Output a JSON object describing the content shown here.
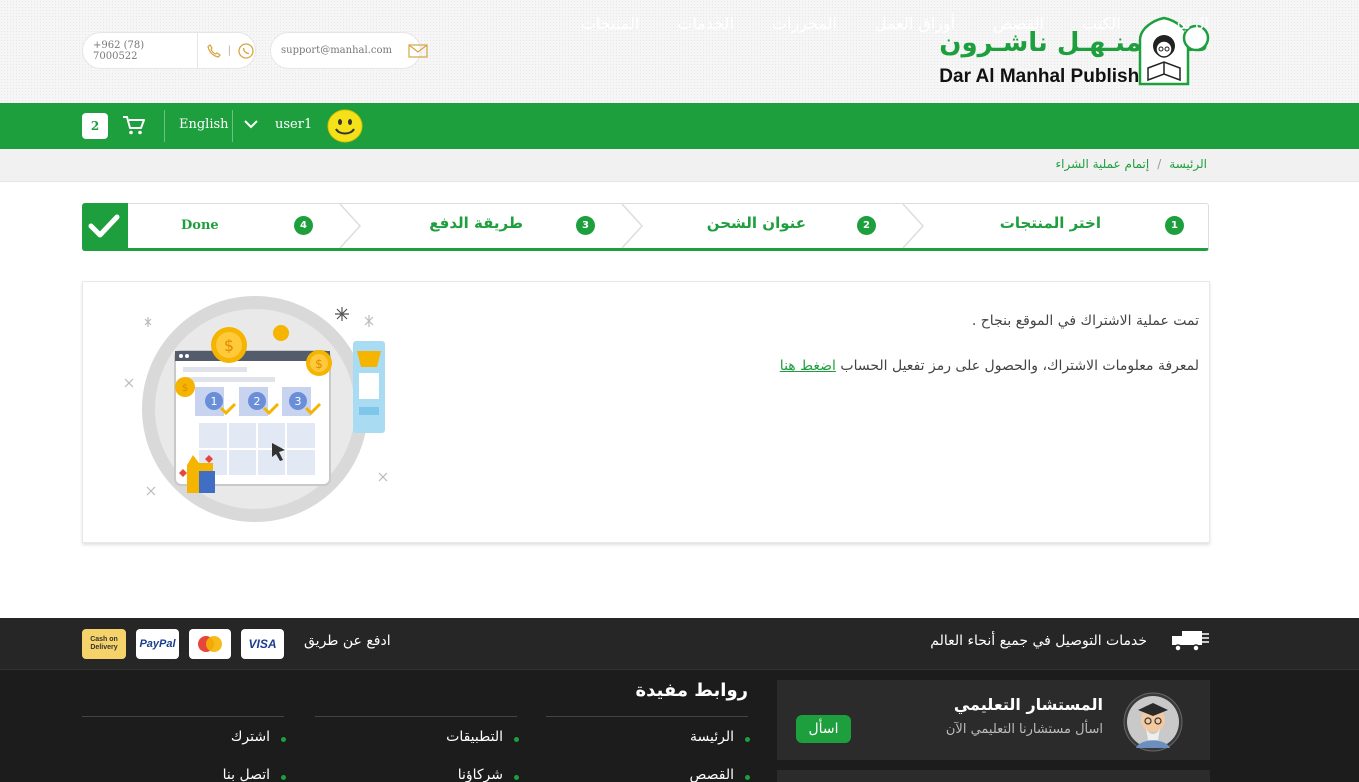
{
  "header": {
    "phone": "+962 (78) 7000522",
    "email": "support@manhal.com",
    "logo_ar": "دار المنـهـل ناشـرون",
    "logo_en": "Dar Al Manhal Publishers"
  },
  "nav": {
    "links": [
      "الرئيسة",
      "الكتب",
      "القصص",
      "أوراق العمل",
      "المحررات",
      "الخدمات",
      "المنتجات"
    ],
    "cart_count": "2",
    "language": "English",
    "username": "user1"
  },
  "breadcrumb": {
    "home": "الرئيسة",
    "separator": "/",
    "current": "إتمام عملية الشراء"
  },
  "steps": [
    {
      "num": "1",
      "label": "اختر المنتجات"
    },
    {
      "num": "2",
      "label": "عنوان الشحن"
    },
    {
      "num": "3",
      "label": "طريقة الدفع"
    },
    {
      "num": "4",
      "label": "Done"
    }
  ],
  "content": {
    "message": "تمت عملية الاشتراك في الموقع بنجاح .",
    "info_text": "لمعرفة معلومات الاشتراك، والحصول على رمز تفعيل الحساب",
    "info_link": "اضغط هنا"
  },
  "footer": {
    "shipping_text": "خدمات التوصيل في جميع أنحاء العالم",
    "pay_text": "ادفع عن طريق",
    "cards": [
      "VISA",
      "MasterCard",
      "PayPal",
      "Cash on Delivery"
    ],
    "links_title": "روابط مفيدة",
    "links_col1": [
      "الرئيسة",
      "القصص"
    ],
    "links_col2": [
      "التطبيقات",
      "شركاؤنا"
    ],
    "links_col3": [
      "اشترك",
      "اتصل بنا"
    ],
    "advisor_title": "المستشار التعليمي",
    "advisor_sub": "اسأل مستشارنا التعليمي الآن",
    "ask_label": "اسأل"
  },
  "colors": {
    "brand_green": "#1e9f3e",
    "footer_dark": "#1c1c1c"
  }
}
